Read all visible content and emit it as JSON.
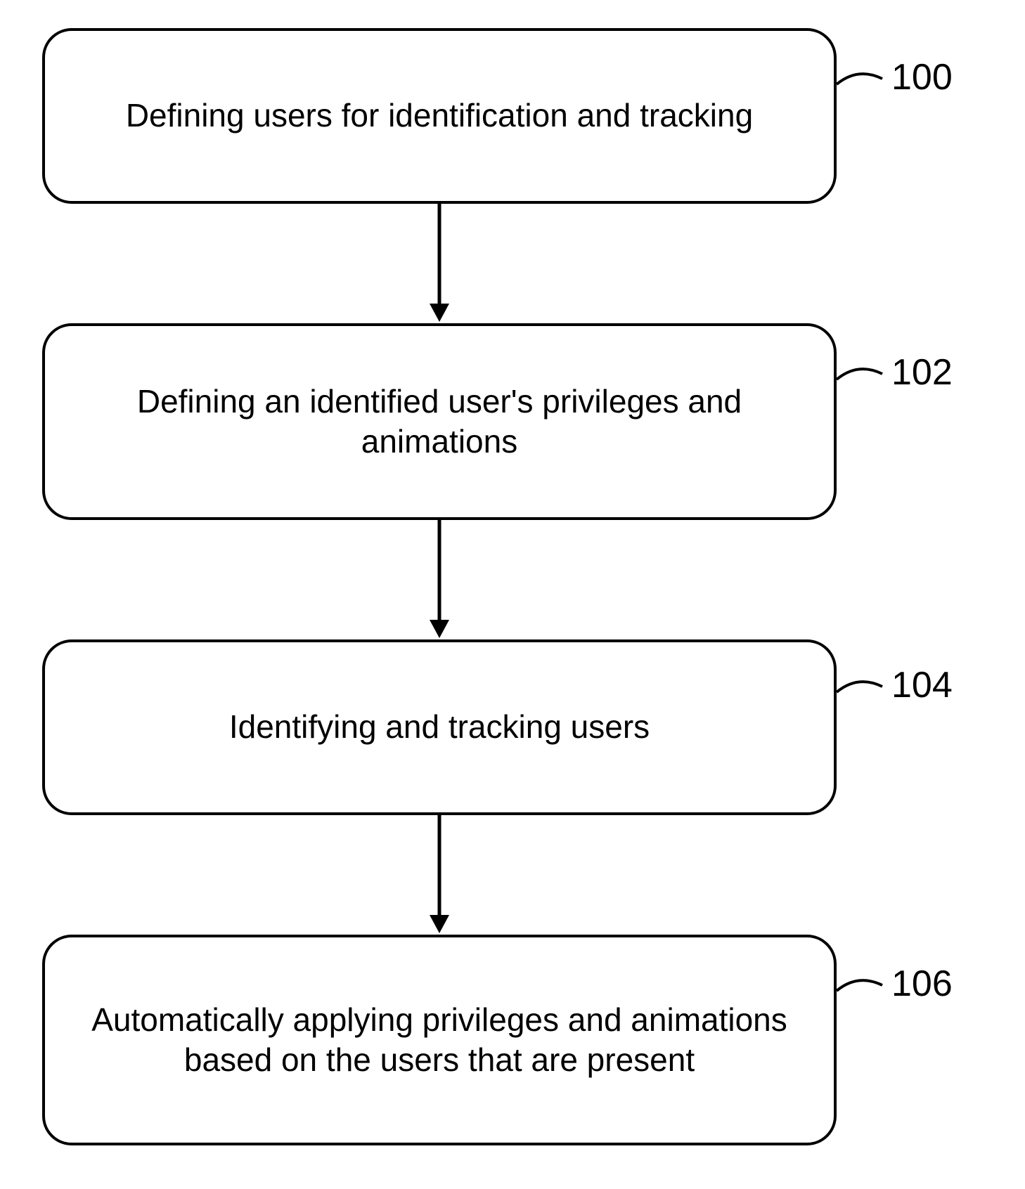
{
  "steps": [
    {
      "text": "Defining users for identification and tracking",
      "label": "100"
    },
    {
      "text": "Defining an identified user's privileges and animations",
      "label": "102"
    },
    {
      "text": "Identifying and tracking users",
      "label": "104"
    },
    {
      "text": "Automatically applying privileges and animations based on the users that are present",
      "label": "106"
    }
  ]
}
